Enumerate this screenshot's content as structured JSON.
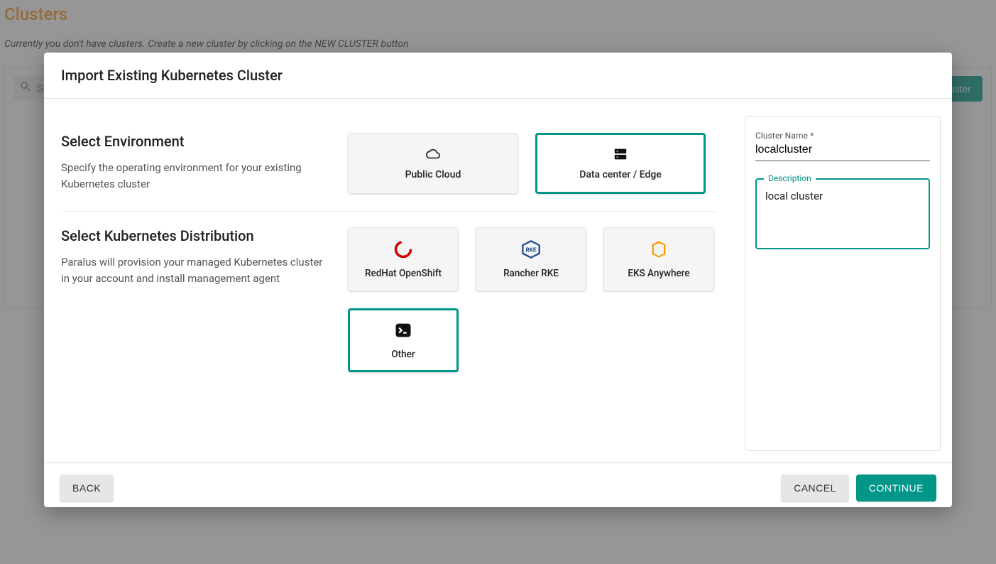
{
  "page": {
    "title": "Clusters",
    "subtitle": "Currently you don't have clusters. Create a new cluster by clicking on the NEW CLUSTER button",
    "search_placeholder": "Search",
    "new_cluster_label": "+ New Cluster"
  },
  "dialog": {
    "title": "Import Existing Kubernetes Cluster",
    "env_section": {
      "heading": "Select Environment",
      "description": "Specify the operating environment for your existing Kubernetes cluster",
      "options": {
        "public_cloud": "Public Cloud",
        "data_center": "Data center / Edge"
      },
      "selected": "data_center"
    },
    "distro_section": {
      "heading": "Select Kubernetes Distribution",
      "description": "Paralus will provision your managed Kubernetes cluster in your account and install management agent",
      "options": {
        "openshift": "RedHat OpenShift",
        "rancher": "Rancher RKE",
        "eks": "EKS Anywhere",
        "other": "Other"
      },
      "selected": "other"
    },
    "form": {
      "cluster_name_label": "Cluster Name *",
      "cluster_name_value": "localcluster",
      "description_label": "Description",
      "description_value": "local cluster"
    },
    "buttons": {
      "back": "Back",
      "cancel": "Cancel",
      "continue": "Continue"
    }
  },
  "colors": {
    "accent": "#009688",
    "brand_orange": "#f7941e"
  }
}
